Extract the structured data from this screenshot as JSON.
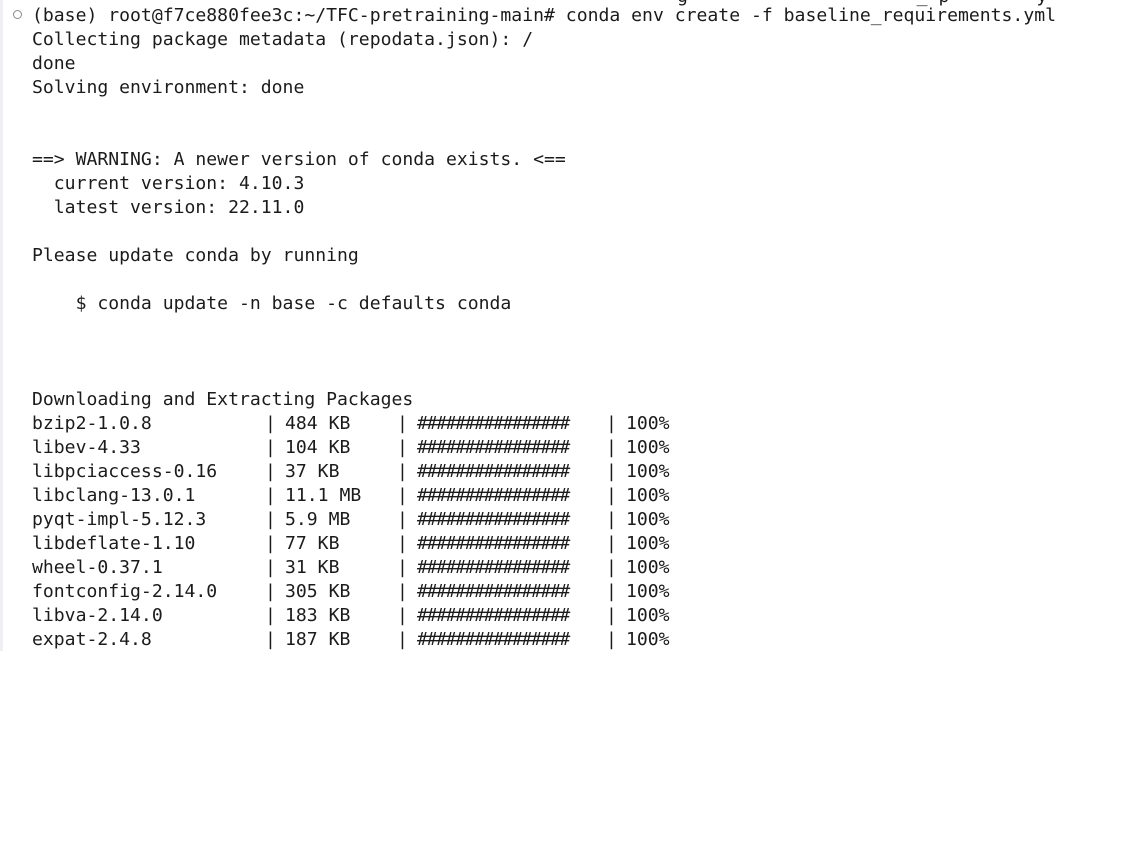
{
  "terminal": {
    "cutoff_top_text": "g                     _ p        y",
    "prompt": "(base) root@f7ce880fee3c:~/TFC-pretraining-main#",
    "command": "conda env create -f baseline_requirements.yml",
    "output_lines": [
      "Collecting package metadata (repodata.json): /",
      "done",
      "Solving environment: done",
      "",
      "",
      "==> WARNING: A newer version of conda exists. <==",
      "  current version: 4.10.3",
      "  latest version: 22.11.0",
      "",
      "Please update conda by running",
      "",
      "    $ conda update -n base -c defaults conda",
      "",
      "",
      "",
      "Downloading and Extracting Packages"
    ],
    "separator": "|",
    "packages": [
      {
        "name": "bzip2-1.0.8",
        "size": "484 KB",
        "bar": "################",
        "percent": "100%"
      },
      {
        "name": "libev-4.33",
        "size": "104 KB",
        "bar": "################",
        "percent": "100%"
      },
      {
        "name": "libpciaccess-0.16",
        "size": "37 KB",
        "bar": "################",
        "percent": "100%"
      },
      {
        "name": "libclang-13.0.1",
        "size": "11.1 MB",
        "bar": "################",
        "percent": "100%"
      },
      {
        "name": "pyqt-impl-5.12.3",
        "size": "5.9 MB",
        "bar": "################",
        "percent": "100%"
      },
      {
        "name": "libdeflate-1.10",
        "size": "77 KB",
        "bar": "################",
        "percent": "100%"
      },
      {
        "name": "wheel-0.37.1",
        "size": "31 KB",
        "bar": "################",
        "percent": "100%"
      },
      {
        "name": "fontconfig-2.14.0",
        "size": "305 KB",
        "bar": "################",
        "percent": "100%"
      },
      {
        "name": "libva-2.14.0",
        "size": "183 KB",
        "bar": "################",
        "percent": "100%"
      },
      {
        "name": "expat-2.4.8",
        "size": "187 KB",
        "bar": "################",
        "percent": "100%"
      }
    ]
  }
}
